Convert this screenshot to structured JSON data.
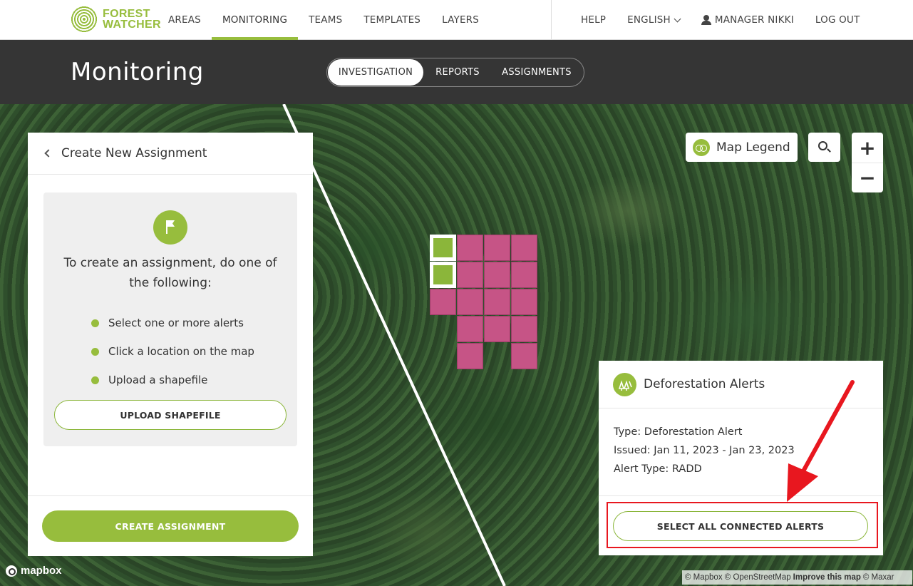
{
  "brand": {
    "line1": "FOREST",
    "line2": "WATCHER"
  },
  "nav": {
    "items": [
      {
        "label": "AREAS",
        "active": false
      },
      {
        "label": "MONITORING",
        "active": true
      },
      {
        "label": "TEAMS",
        "active": false
      },
      {
        "label": "TEMPLATES",
        "active": false
      },
      {
        "label": "LAYERS",
        "active": false
      }
    ],
    "help": "HELP",
    "language": "ENGLISH",
    "user": "MANAGER NIKKI",
    "logout": "LOG OUT"
  },
  "header": {
    "title": "Monitoring",
    "tabs": [
      {
        "label": "INVESTIGATION",
        "active": true
      },
      {
        "label": "REPORTS",
        "active": false
      },
      {
        "label": "ASSIGNMENTS",
        "active": false
      }
    ]
  },
  "assignment_panel": {
    "title": "Create New Assignment",
    "intro": "To create an assignment, do one of the following:",
    "options": [
      "Select one or more alerts",
      "Click a location on the map",
      "Upload a shapefile"
    ],
    "upload_label": "UPLOAD SHAPEFILE",
    "create_label": "CREATE ASSIGNMENT"
  },
  "map_controls": {
    "legend_label": "Map Legend",
    "zoom_in": "+",
    "zoom_out": "−"
  },
  "alerts_panel": {
    "title": "Deforestation Alerts",
    "type": "Type: Deforestation Alert",
    "issued": "Issued: Jan 11, 2023 - Jan 23, 2023",
    "alert_type": "Alert Type: RADD",
    "select_label": "SELECT ALL CONNECTED ALERTS"
  },
  "attribution": {
    "mapbox": "mapbox",
    "copyright_mapbox": "© Mapbox",
    "copyright_osm": "© OpenStreetMap",
    "improve": "Improve this map",
    "copyright_maxar": "© Maxar"
  },
  "colors": {
    "accent": "#97bd3d",
    "alert": "#c65486",
    "header": "#353535",
    "annotation": "#e8171f"
  }
}
